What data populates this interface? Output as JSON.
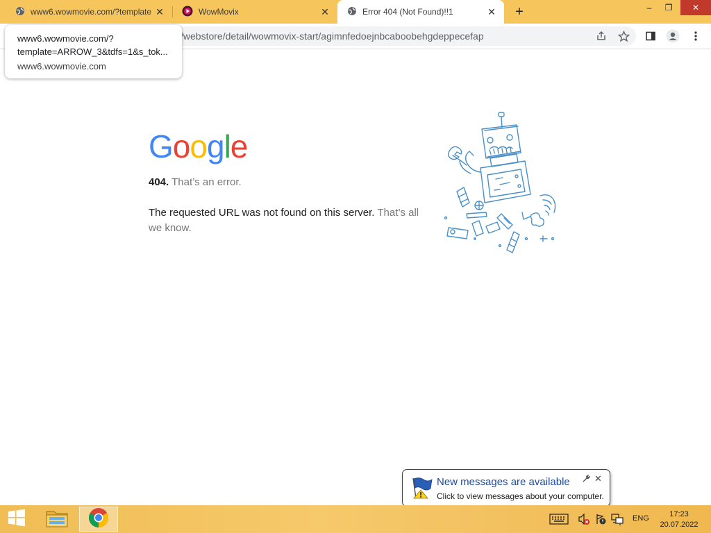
{
  "browser": {
    "tabs": [
      {
        "title": "www6.wowmovie.com/?template",
        "icon": "globe-icon",
        "active": false
      },
      {
        "title": "WowMovix",
        "icon": "wowmovix-icon",
        "active": false
      },
      {
        "title": "Error 404 (Not Found)!!1",
        "icon": "globe-icon",
        "active": true
      }
    ],
    "new_tab": "+",
    "window_controls": {
      "minimize": "–",
      "maximize": "❐",
      "close": "✕"
    },
    "url": "/webstore/detail/wowmovix-start/agimnfedoejnbcaboobehgdeppecefap"
  },
  "tooltip": {
    "line1": "www6.wowmovie.com/?",
    "line2": "template=ARROW_3&tdfs=1&s_tok...",
    "line3": "www6.wowmovie.com"
  },
  "page": {
    "logo": "Google",
    "error_code": "404.",
    "error_text": "That’s an error.",
    "message_main": "The requested URL was not found on this server.",
    "message_muted": "That’s all we know."
  },
  "colors": {
    "google_blue": "#4285F4",
    "google_red": "#EA4335",
    "google_yellow": "#FBBC05",
    "google_green": "#34A853",
    "taskbar": "#f3c160",
    "tabstrip": "#f6c65c"
  },
  "notification": {
    "title": "New messages are available",
    "text": "Click to view messages about your computer."
  },
  "taskbar": {
    "language": "ENG",
    "time": "17:23",
    "date": "20.07.2022"
  }
}
